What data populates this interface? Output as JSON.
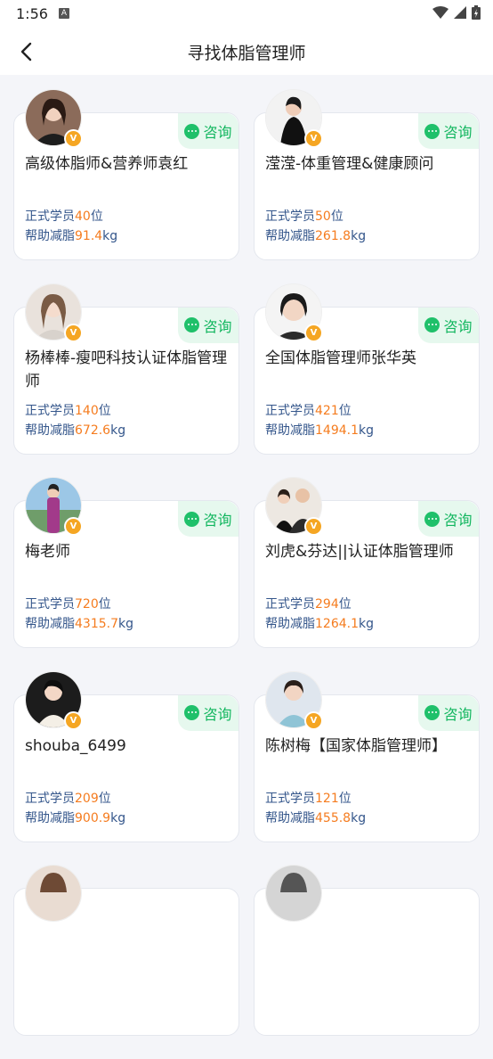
{
  "status_bar": {
    "time": "1:56"
  },
  "header": {
    "title": "寻找体脂管理师"
  },
  "labels": {
    "consult": "咨询",
    "students_prefix": "正式学员",
    "students_suffix": "位",
    "fat_prefix": "帮助减脂",
    "fat_suffix": "kg",
    "verified_badge": "V"
  },
  "colors": {
    "accent_green": "#12b65f",
    "number_orange": "#f57c1f",
    "stat_blue": "#34568b",
    "badge_gold": "#f5a623"
  },
  "coaches": [
    {
      "name": "高级体脂师&营养师袁红",
      "students": "40",
      "fat_loss": "91.4"
    },
    {
      "name": "滢滢-体重管理&健康顾问",
      "students": "50",
      "fat_loss": "261.8"
    },
    {
      "name": "杨棒棒-瘦吧科技认证体脂管理师",
      "students": "140",
      "fat_loss": "672.6"
    },
    {
      "name": "全国体脂管理师张华英",
      "students": "421",
      "fat_loss": "1494.1"
    },
    {
      "name": "梅老师",
      "students": "720",
      "fat_loss": "4315.7"
    },
    {
      "name": "刘虎&芬达||认证体脂管理师",
      "students": "294",
      "fat_loss": "1264.1"
    },
    {
      "name": "shouba_6499",
      "students": "209",
      "fat_loss": "900.9"
    },
    {
      "name": "陈树梅【国家体脂管理师】",
      "students": "121",
      "fat_loss": "455.8"
    },
    {
      "name": "",
      "students": "",
      "fat_loss": ""
    },
    {
      "name": "",
      "students": "",
      "fat_loss": ""
    }
  ]
}
